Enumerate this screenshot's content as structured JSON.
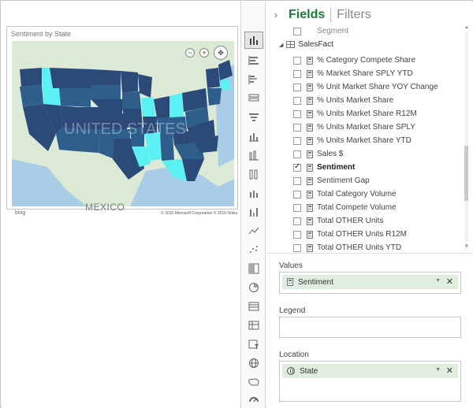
{
  "map_visual": {
    "title": "Sentiment by State",
    "country_label": "UNITED STATES",
    "mexico_label": "MEXICO",
    "bing_label": "bing",
    "copyright": "© 2015 Microsoft Corporation   © 2015 Nokia",
    "zoom_in": "+",
    "zoom_out": "−",
    "colors": {
      "dark": "#2b4a78",
      "mid": "#2e5f8c",
      "light": "#5bf0f2",
      "land": "#dce9d5",
      "water": "#a9cde7"
    }
  },
  "viz_picker": {
    "icons": [
      "stacked-bar-chart-icon",
      "bar-chart-icon",
      "clustered-bar-chart-icon",
      "100-stacked-bar-icon",
      "funnel-icon",
      "column-chart-icon",
      "clustered-column-icon",
      "100-stacked-column-icon",
      "line-column-icon",
      "waterfall-icon",
      "line-chart-icon",
      "scatter-chart-icon",
      "treemap-icon",
      "pie-chart-icon",
      "table-icon",
      "matrix-icon",
      "slicer-icon",
      "globe-map-icon",
      "filled-map-icon",
      "gauge-icon"
    ]
  },
  "fields_pane": {
    "tab_fields": "Fields",
    "tab_filters": "Filters",
    "partial_field": "Segment",
    "table_name": "SalesFact",
    "fields": [
      {
        "label": "% Category Compete Share",
        "checked": false
      },
      {
        "label": "% Market Share SPLY YTD",
        "checked": false
      },
      {
        "label": "% Unit Market Share YOY Change",
        "checked": false
      },
      {
        "label": "% Units Market Share",
        "checked": false
      },
      {
        "label": "% Units Market Share R12M",
        "checked": false
      },
      {
        "label": "% Units Market Share SPLY",
        "checked": false
      },
      {
        "label": "% Units Market Share YTD",
        "checked": false
      },
      {
        "label": "Sales $",
        "checked": false
      },
      {
        "label": "Sentiment",
        "checked": true
      },
      {
        "label": "Sentiment Gap",
        "checked": false
      },
      {
        "label": "Total Category Volume",
        "checked": false
      },
      {
        "label": "Total Compete Volume",
        "checked": false
      },
      {
        "label": "Total OTHER Units",
        "checked": false
      },
      {
        "label": "Total OTHER Units R12M",
        "checked": false
      },
      {
        "label": "Total OTHER Units YTD",
        "checked": false
      }
    ]
  },
  "wells": {
    "values_label": "Values",
    "values_field": "Sentiment",
    "legend_label": "Legend",
    "location_label": "Location",
    "location_field": "State"
  }
}
